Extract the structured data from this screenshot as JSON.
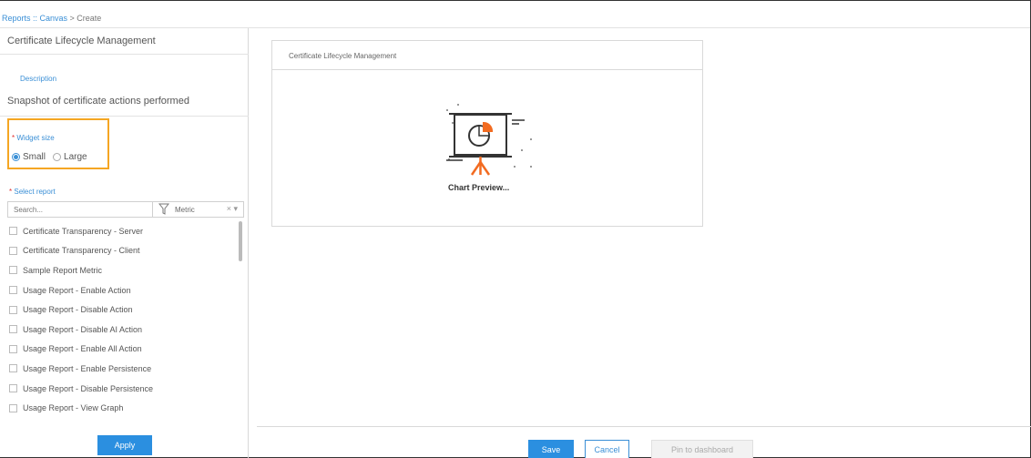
{
  "breadcrumb": {
    "link": "Reports :: Canvas",
    "separator": " > ",
    "current": "Create"
  },
  "form": {
    "title_value": "Certificate Lifecycle Management",
    "description_label": "Description",
    "description_value": "Snapshot of certificate actions performed",
    "widget_size": {
      "required_mark": "*",
      "label": "Widget size",
      "options": [
        "Small",
        "Large"
      ],
      "selected": "Small"
    },
    "select_report": {
      "required_mark": "*",
      "label": "Select report",
      "search_placeholder": "Search...",
      "filter_value": "Metric",
      "clear_glyph": "×",
      "dropdown_glyph": "▾"
    },
    "reports": [
      "Certificate Transparency - Server",
      "Certificate Transparency - Client",
      "Sample Report Metric",
      "Usage Report - Enable Action",
      "Usage Report - Disable Action",
      "Usage Report - Disable AI Action",
      "Usage Report - Enable All Action",
      "Usage Report - Enable Persistence",
      "Usage Report - Disable Persistence",
      "Usage Report - View Graph"
    ],
    "apply_label": "Apply"
  },
  "preview": {
    "card_title": "Certificate Lifecycle Management",
    "placeholder_text": "Chart Preview..."
  },
  "footer": {
    "save_label": "Save",
    "cancel_label": "Cancel",
    "pin_label": "Pin to dashboard"
  },
  "colors": {
    "accent": "#2b8fe0",
    "highlight": "#f5a623",
    "icon_orange": "#f26b21"
  }
}
